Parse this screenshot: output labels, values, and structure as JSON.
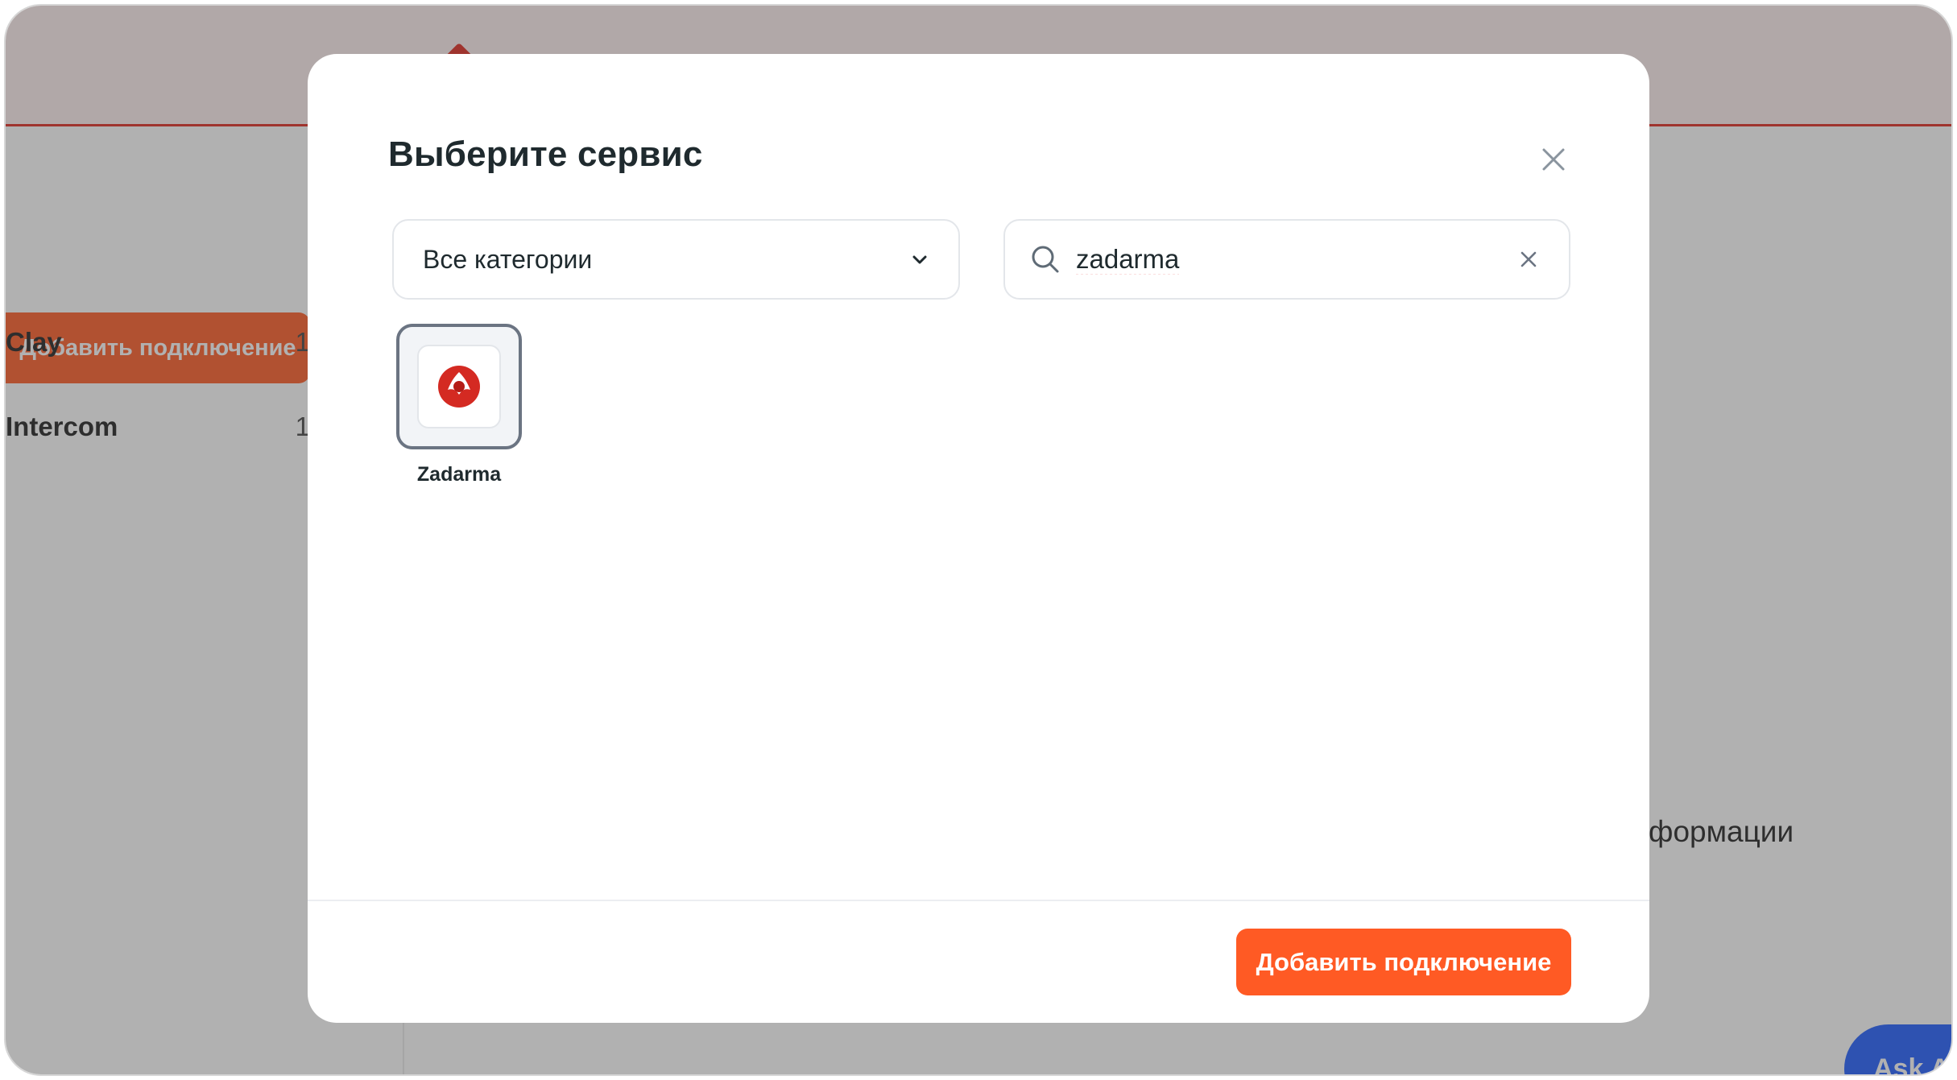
{
  "background": {
    "sidebar": {
      "add_button_label": "Добавить подключение",
      "items": [
        {
          "label": "Clay",
          "count": "1"
        },
        {
          "label": "Intercom",
          "count": "1"
        }
      ]
    },
    "main": {
      "partial_text": "формации"
    },
    "ask_ai_label": "Ask AI"
  },
  "modal": {
    "title": "Выберите сервис",
    "category_select": {
      "value": "Все категории"
    },
    "search": {
      "value": "zadarma"
    },
    "services": [
      {
        "name": "Zadarma",
        "icon": "zadarma-logo-icon",
        "selected": true
      }
    ],
    "primary_button_label": "Добавить подключение"
  },
  "colors": {
    "accent": "#ff5a24",
    "brand_red": "#e0281e",
    "ask_ai_blue": "#1e5cff"
  }
}
